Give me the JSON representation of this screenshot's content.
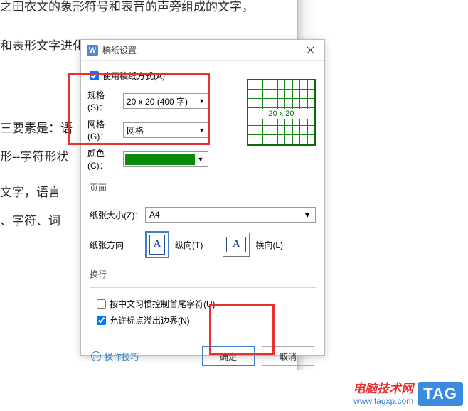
{
  "bgText": {
    "line1": "之田衣文的象形符号和表音的声旁组成的文字，",
    "line2": "和表形文字进化成的意音文字，汉字也是语素文字",
    "line3": "三要素是：语",
    "line4": "形--字符形状",
    "line5": "文字，语言",
    "line6": "、字符、词"
  },
  "dialog": {
    "title": "稿纸设置",
    "useGridLabel": "使用稿纸方式(A)",
    "useGridChecked": true,
    "spec": {
      "label": "规格(S)：",
      "value": "20 x 20 (400 字)"
    },
    "grid": {
      "label": "网格(G)：",
      "value": "网格"
    },
    "color": {
      "label": "颜色(C)：",
      "hex": "#0a8a0a"
    },
    "gridPreviewLabel": "20 x 20",
    "pageSection": "页面",
    "paperSize": {
      "label": "纸张大小(Z)：",
      "value": "A4"
    },
    "orientation": {
      "label": "纸张方向",
      "portrait": "纵向(T)",
      "landscape": "横向(L)",
      "glyph": "A"
    },
    "wrapSection": "换行",
    "wrap1": {
      "label": "按中文习惯控制首尾字符(U)",
      "checked": false
    },
    "wrap2": {
      "label": "允许标点溢出边界(N)",
      "checked": true
    },
    "tipsLabel": "操作技巧",
    "okLabel": "确定",
    "cancelLabel": "取消"
  },
  "watermark": {
    "cn": "电脑技术网",
    "url": "www.tagxp.com",
    "tag": "TAG"
  }
}
